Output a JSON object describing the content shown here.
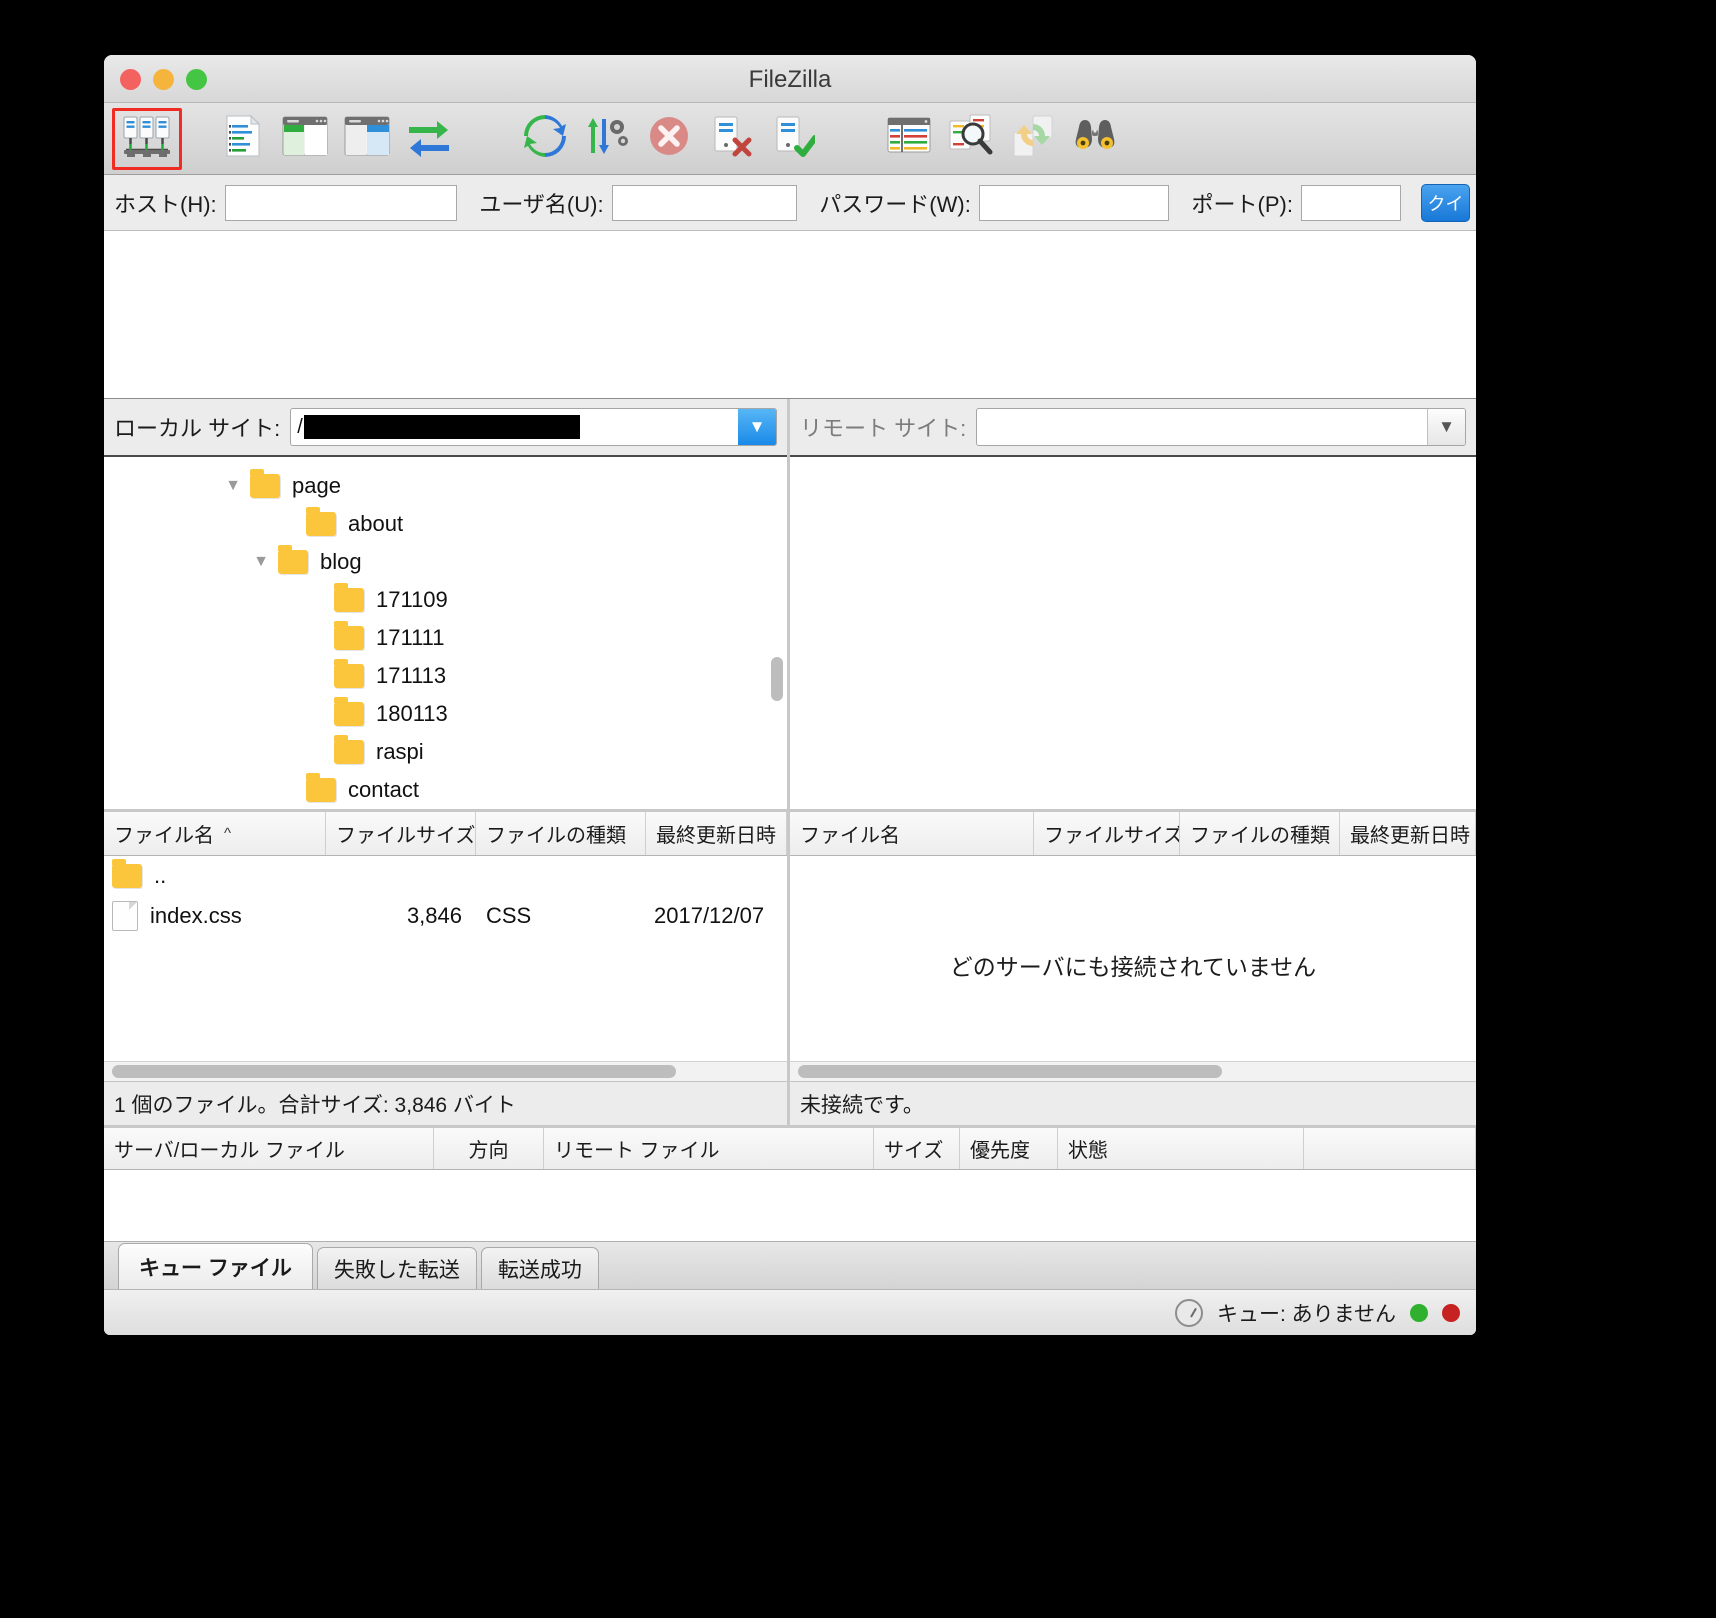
{
  "window": {
    "title": "FileZilla",
    "traffic_lights": [
      "close",
      "minimize",
      "zoom"
    ]
  },
  "toolbar": {
    "buttons": [
      {
        "name": "site-manager",
        "icon": "site-manager-icon",
        "selected": true
      },
      {
        "name": "toggle-message-log",
        "icon": "message-log-icon",
        "selected": false
      },
      {
        "name": "toggle-local-tree",
        "icon": "local-tree-icon",
        "selected": false
      },
      {
        "name": "toggle-remote-tree",
        "icon": "remote-tree-icon",
        "selected": false
      },
      {
        "name": "toggle-transfer-queue",
        "icon": "transfer-arrows-icon",
        "selected": false
      },
      {
        "name": "refresh",
        "icon": "refresh-icon",
        "selected": false
      },
      {
        "name": "transfer-settings",
        "icon": "transfer-settings-icon",
        "selected": false
      },
      {
        "name": "cancel-operation",
        "icon": "cancel-circle-icon",
        "selected": false
      },
      {
        "name": "disconnect",
        "icon": "disconnect-icon",
        "selected": false
      },
      {
        "name": "reconnect",
        "icon": "reconnect-icon",
        "selected": false
      },
      {
        "name": "filter",
        "icon": "filter-list-icon",
        "selected": false
      },
      {
        "name": "directory-comparison",
        "icon": "compare-magnifier-icon",
        "selected": false
      },
      {
        "name": "synchronized-browsing",
        "icon": "sync-browsing-icon",
        "selected": false
      },
      {
        "name": "find-files",
        "icon": "binoculars-icon",
        "selected": false
      }
    ]
  },
  "quickconnect": {
    "host_label": "ホスト(H):",
    "host_value": "",
    "user_label": "ユーザ名(U):",
    "user_value": "",
    "password_label": "パスワード(W):",
    "password_value": "",
    "port_label": "ポート(P):",
    "port_value": "",
    "connect_label": "クイ"
  },
  "local_pane": {
    "site_label": "ローカル サイト:",
    "path_prefix": "/",
    "path_redacted": true,
    "tree": [
      {
        "label": "page",
        "depth": 1,
        "twisty": "▼",
        "type": "folder"
      },
      {
        "label": "about",
        "depth": 2,
        "twisty": "",
        "type": "folder"
      },
      {
        "label": "blog",
        "depth": 2,
        "twisty": "▼",
        "type": "folder"
      },
      {
        "label": "171109",
        "depth": 3,
        "twisty": "",
        "type": "folder"
      },
      {
        "label": "171111",
        "depth": 3,
        "twisty": "",
        "type": "folder"
      },
      {
        "label": "171113",
        "depth": 3,
        "twisty": "",
        "type": "folder"
      },
      {
        "label": "180113",
        "depth": 3,
        "twisty": "",
        "type": "folder"
      },
      {
        "label": "raspi",
        "depth": 3,
        "twisty": "",
        "type": "folder"
      },
      {
        "label": "contact",
        "depth": 2,
        "twisty": "",
        "type": "folder"
      }
    ],
    "columns": [
      {
        "label": "ファイル名",
        "sorted": true,
        "caret": "^"
      },
      {
        "label": "ファイルサイズ",
        "sorted": false
      },
      {
        "label": "ファイルの種類",
        "sorted": false
      },
      {
        "label": "最終更新日時",
        "sorted": false
      }
    ],
    "rows": [
      {
        "name": "..",
        "size": "",
        "type": "",
        "date": "",
        "icon": "folder-icon"
      },
      {
        "name": "index.css",
        "size": "3,846",
        "type": "CSS",
        "date": "2017/12/07",
        "icon": "file-icon"
      }
    ],
    "status": "1 個のファイル。合計サイズ: 3,846 バイト"
  },
  "remote_pane": {
    "site_label": "リモート サイト:",
    "path_value": "",
    "empty_message": "どのサーバにも接続されていません",
    "columns": [
      {
        "label": "ファイル名"
      },
      {
        "label": "ファイルサイズ"
      },
      {
        "label": "ファイルの種類"
      },
      {
        "label": "最終更新日時"
      }
    ],
    "rows": [],
    "status": "未接続です。"
  },
  "queue": {
    "columns": [
      {
        "label": "サーバ/ローカル ファイル"
      },
      {
        "label": "方向"
      },
      {
        "label": "リモート ファイル"
      },
      {
        "label": "サイズ"
      },
      {
        "label": "優先度"
      },
      {
        "label": "状態"
      }
    ],
    "rows": []
  },
  "tabs": [
    {
      "label": "キュー ファイル",
      "active": true
    },
    {
      "label": "失敗した転送",
      "active": false
    },
    {
      "label": "転送成功",
      "active": false
    }
  ],
  "statusbar": {
    "queue_text": "キュー: ありません",
    "led_left_color": "#2fb12f",
    "led_right_color": "#c62222"
  },
  "colors": {
    "selection_highlight": "#ef2b24",
    "folder": "#fcc63c",
    "accent_blue": "#1878d8"
  }
}
